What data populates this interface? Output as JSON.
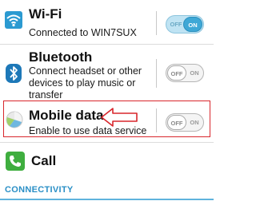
{
  "settings": {
    "wifi": {
      "title": "Wi-Fi",
      "subtitle": "Connected to WIN7SUX",
      "toggle_state": "on",
      "off_label": "OFF",
      "on_label": "ON",
      "icon": "wifi-icon"
    },
    "bluetooth": {
      "title": "Bluetooth",
      "subtitle_lines": [
        "Connect headset or other",
        "devices to play music or",
        "transfer"
      ],
      "toggle_state": "off",
      "off_label": "OFF",
      "on_label": "ON",
      "icon": "bluetooth-icon"
    },
    "mobile_data": {
      "title": "Mobile data",
      "subtitle": "Enable to use data service",
      "toggle_state": "off",
      "off_label": "OFF",
      "on_label": "ON",
      "icon": "mobile-data-icon"
    },
    "call": {
      "title": "Call",
      "icon": "phone-icon"
    }
  },
  "section_header": "CONNECTIVITY",
  "colors": {
    "accent": "#3fa8d6",
    "highlight_border": "#d8262c",
    "section_text": "#2a8fc6",
    "call_icon_green": "#3fae3f"
  }
}
